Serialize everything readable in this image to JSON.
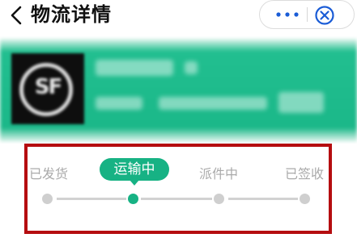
{
  "header": {
    "title": "物流详情"
  },
  "tracker": {
    "steps": [
      {
        "label": "已发货"
      },
      {
        "label": "运输中"
      },
      {
        "label": "派件中"
      },
      {
        "label": "已签收"
      }
    ],
    "active_step": "运输中"
  },
  "colors": {
    "accent": "#17b284",
    "banner": "#1bb889",
    "highlight_frame": "#b50d10",
    "inactive": "#cfcfcf"
  }
}
